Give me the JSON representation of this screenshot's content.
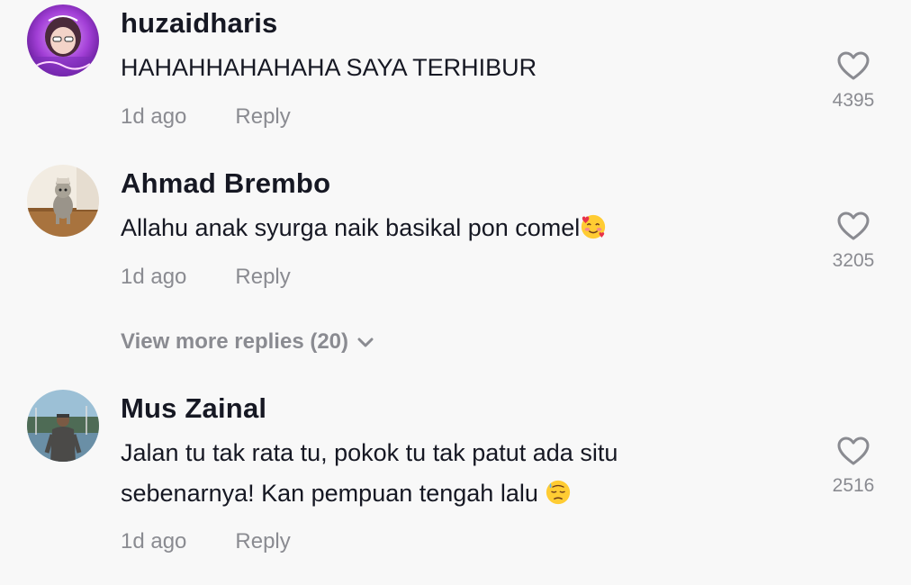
{
  "comments": [
    {
      "username": "huzaidharis",
      "text": "HAHAHHAHAHAHA SAYA TERHIBUR",
      "time": "1d ago",
      "reply_label": "Reply",
      "likes": "4395",
      "avatar_icon": "anime-avatar-icon"
    },
    {
      "username": "Ahmad Brembo",
      "text": "Allahu anak syurga naik basikal pon comel",
      "emoji": "smiling-face-with-hearts-emoji",
      "time": "1d ago",
      "reply_label": "Reply",
      "likes": "3205",
      "avatar_icon": "cat-photo-avatar"
    },
    {
      "username": "Mus Zainal",
      "text_line1": "Jalan tu tak rata tu, pokok tu tak patut ada situ",
      "text_line2": "sebenarnya! Kan pempuan tengah lalu",
      "emoji": "downcast-face-with-sweat-emoji",
      "time": "1d ago",
      "reply_label": "Reply",
      "likes": "2516",
      "avatar_icon": "person-photo-avatar"
    }
  ],
  "view_more_replies": "View more replies (20)",
  "colors": {
    "background": "#f8f8f8",
    "primary_text": "#161823",
    "secondary_text": "#8a8b91"
  }
}
